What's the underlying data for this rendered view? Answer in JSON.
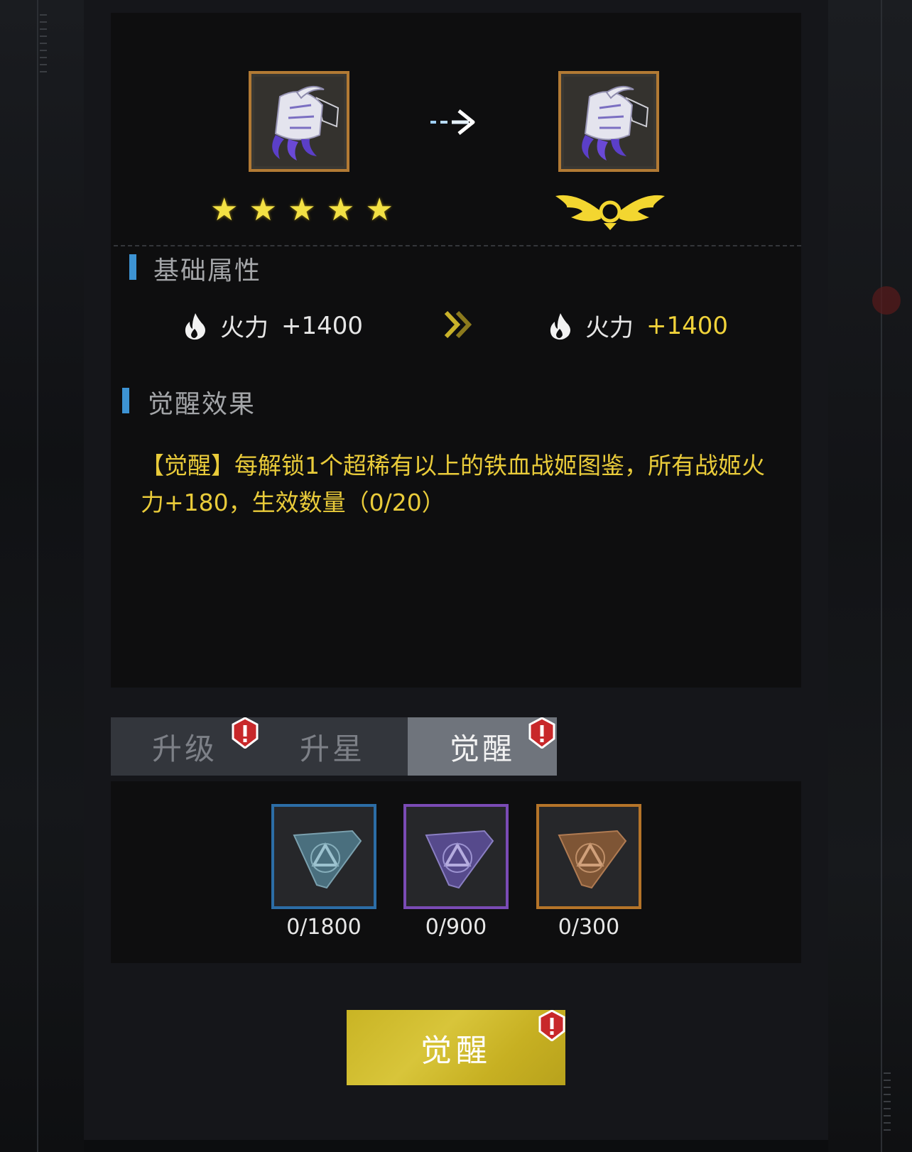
{
  "compare": {
    "from_stars": [
      "★",
      "★",
      "★",
      "★",
      "★"
    ],
    "arrow_icon": "dashed-arrow-right-icon",
    "to_rank_icon": "winged-emblem-icon"
  },
  "basic_attr": {
    "title": "基础属性",
    "from": {
      "label": "火力",
      "value": "+1400"
    },
    "to": {
      "label": "火力",
      "value": "+1400"
    }
  },
  "awaken_effect": {
    "title": "觉醒效果",
    "text": "【觉醒】每解锁1个超稀有以上的铁血战姬图鉴，所有战姬火力+180，生效数量（0/20）"
  },
  "tabs": [
    {
      "label": "升级",
      "active": false,
      "badge": true
    },
    {
      "label": "升星",
      "active": false,
      "badge": false
    },
    {
      "label": "觉醒",
      "active": true,
      "badge": true
    }
  ],
  "materials": [
    {
      "count": "0/1800",
      "color": "#2c6da6"
    },
    {
      "count": "0/900",
      "color": "#7a4bb5"
    },
    {
      "count": "0/300",
      "color": "#b57429"
    }
  ],
  "action": {
    "label": "觉醒"
  },
  "colors": {
    "accent_gold": "#f0d23a",
    "section_bar": "#3d93d3",
    "badge_red": "#c8282a"
  }
}
